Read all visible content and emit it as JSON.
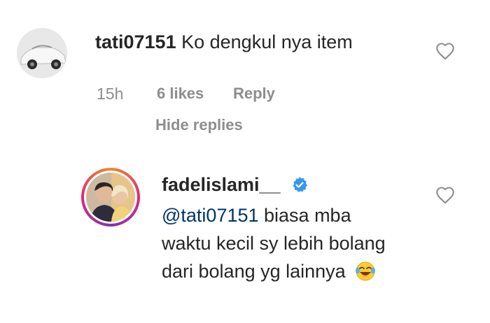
{
  "comment": {
    "username": "tati07151",
    "text": "Ko dengkul nya item",
    "time": "15h",
    "likes": "6 likes",
    "reply_label": "Reply",
    "hide_replies_label": "Hide replies"
  },
  "reply": {
    "username": "fadelislami__",
    "mention": "@tati07151",
    "line1_rest": " biasa mba",
    "line2": "waktu kecil sy lebih bolang",
    "line3": "dari bolang yg lainnya",
    "emoji": "laughing-tears-emoji",
    "verified": true
  },
  "icons": {
    "like": "heart-outline-icon",
    "verified": "verified-badge-icon"
  },
  "colors": {
    "text": "#262626",
    "muted": "#8e8e8e",
    "mention": "#003569",
    "verified": "#3897f0"
  }
}
